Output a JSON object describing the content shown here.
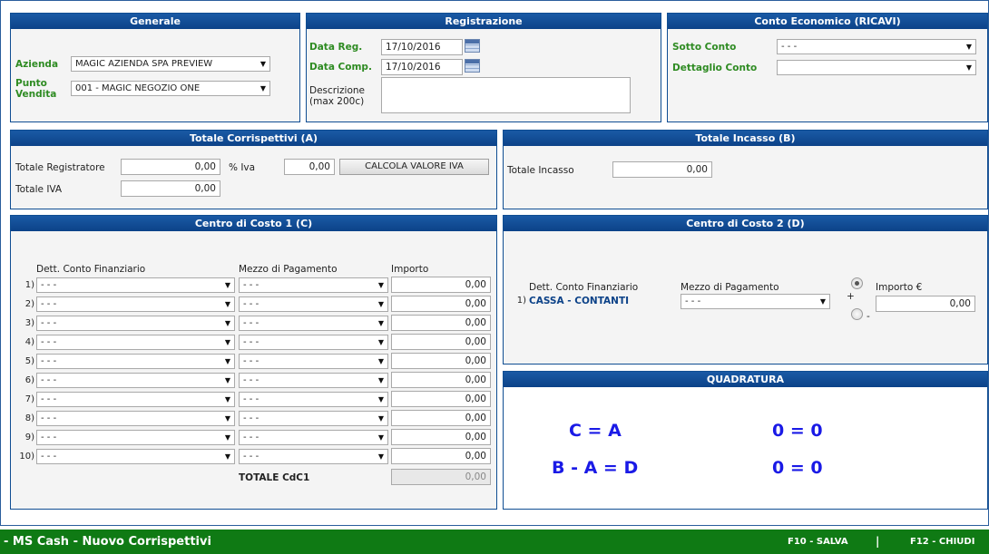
{
  "generale": {
    "title": "Generale",
    "azienda_label": "Azienda",
    "azienda_value": "MAGIC AZIENDA SPA PREVIEW",
    "punto_label_1": "Punto",
    "punto_label_2": "Vendita",
    "punto_value": "001 - MAGIC NEGOZIO ONE"
  },
  "registrazione": {
    "title": "Registrazione",
    "data_reg_label": "Data Reg.",
    "data_reg_value": "17/10/2016",
    "data_comp_label": "Data Comp.",
    "data_comp_value": "17/10/2016",
    "descr_label_1": "Descrizione",
    "descr_label_2": "(max 200c)",
    "descr_value": ""
  },
  "conto_economico": {
    "title": "Conto Economico (RICAVI)",
    "sotto_conto_label": "Sotto Conto",
    "sotto_conto_value": "- - -",
    "dettaglio_label": "Dettaglio Conto",
    "dettaglio_value": ""
  },
  "totale_corrispettivi": {
    "title": "Totale Corrispettivi (A)",
    "registratore_label": "Totale Registratore",
    "registratore_value": "0,00",
    "iva_pct_label": "% Iva",
    "iva_pct_value": "0,00",
    "calc_button": "CALCOLA VALORE IVA",
    "totale_iva_label": "Totale IVA",
    "totale_iva_value": "0,00"
  },
  "totale_incasso": {
    "title": "Totale Incasso (B)",
    "label": "Totale Incasso",
    "value": "0,00"
  },
  "cdc1": {
    "title": "Centro di Costo 1 (C)",
    "col_conto": "Dett. Conto Finanziario",
    "col_mezzo": "Mezzo di Pagamento",
    "col_importo": "Importo",
    "rows": [
      {
        "n": "1)",
        "conto": "- - -",
        "mezzo": "- - -",
        "importo": "0,00"
      },
      {
        "n": "2)",
        "conto": "- - -",
        "mezzo": "- - -",
        "importo": "0,00"
      },
      {
        "n": "3)",
        "conto": "- - -",
        "mezzo": "- - -",
        "importo": "0,00"
      },
      {
        "n": "4)",
        "conto": "- - -",
        "mezzo": "- - -",
        "importo": "0,00"
      },
      {
        "n": "5)",
        "conto": "- - -",
        "mezzo": "- - -",
        "importo": "0,00"
      },
      {
        "n": "6)",
        "conto": "- - -",
        "mezzo": "- - -",
        "importo": "0,00"
      },
      {
        "n": "7)",
        "conto": "- - -",
        "mezzo": "- - -",
        "importo": "0,00"
      },
      {
        "n": "8)",
        "conto": "- - -",
        "mezzo": "- - -",
        "importo": "0,00"
      },
      {
        "n": "9)",
        "conto": "- - -",
        "mezzo": "- - -",
        "importo": "0,00"
      },
      {
        "n": "10)",
        "conto": "- - -",
        "mezzo": "- - -",
        "importo": "0,00"
      }
    ],
    "totale_label": "TOTALE CdC1",
    "totale_value": "0,00"
  },
  "cdc2": {
    "title": "Centro di Costo 2 (D)",
    "col_conto": "Dett. Conto Finanziario",
    "col_mezzo": "Mezzo di Pagamento",
    "col_importo": "Importo €",
    "row_n": "1)",
    "conto_value": "CASSA - CONTANTI",
    "mezzo_value": "- - -",
    "plus": "+",
    "minus": "-",
    "importo_value": "0,00"
  },
  "quadratura": {
    "title": "QUADRATURA",
    "eq1_left": "C = A",
    "eq1_right": "0 = 0",
    "eq2_left": "B - A = D",
    "eq2_right": "0 = 0"
  },
  "footer": {
    "title": "- MS Cash - Nuovo Corrispettivi",
    "f10": "F10 - SALVA",
    "sep": "|",
    "f12": "F12 - CHIUDI"
  },
  "colors": {
    "header_blue": "#0c4288",
    "green_label": "#2e8b22",
    "footer_green": "#0f7a14",
    "quadratura_blue": "#1a1ae6"
  }
}
